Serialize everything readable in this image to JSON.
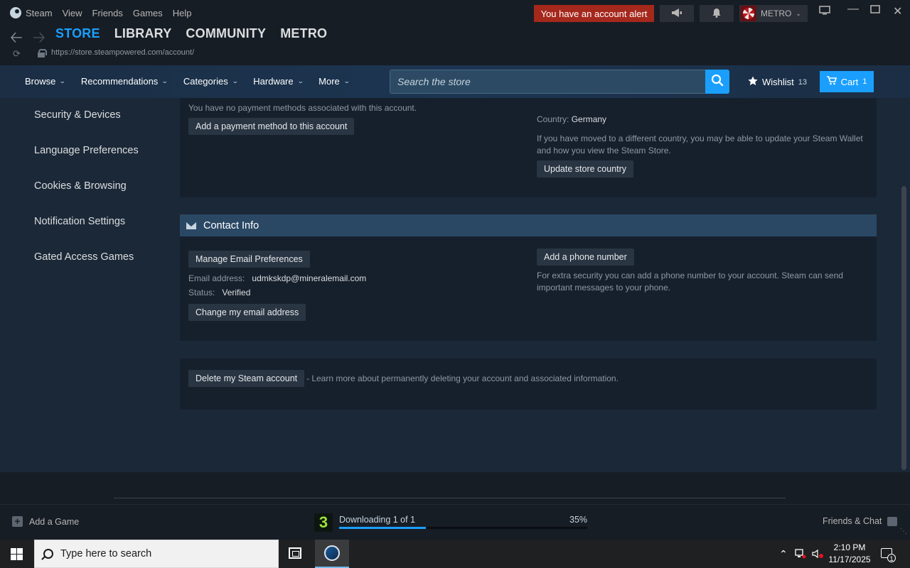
{
  "titlebar": {
    "app": "Steam",
    "menu": [
      "View",
      "Friends",
      "Games",
      "Help"
    ],
    "alert": "You have an account alert",
    "username": "METRO"
  },
  "nav": {
    "tabs": [
      "STORE",
      "LIBRARY",
      "COMMUNITY",
      "METRO"
    ],
    "url": "https://store.steampowered.com/account/"
  },
  "store": {
    "menu": [
      "Browse",
      "Recommendations",
      "Categories",
      "Hardware",
      "More"
    ],
    "search_placeholder": "Search the store",
    "wishlist_label": "Wishlist",
    "wishlist_count": "13",
    "cart_label": "Cart",
    "cart_count": "1"
  },
  "sidebar": {
    "items": [
      "Security & Devices",
      "Language Preferences",
      "Cookies & Browsing",
      "Notification Settings",
      "Gated Access Games"
    ]
  },
  "payment": {
    "no_methods": "You have no payment methods associated with this account.",
    "add_button": "Add a payment method to this account",
    "country_label": "Country:",
    "country_value": "Germany",
    "country_note": "If you have moved to a different country, you may be able to update your Steam Wallet and how you view the Steam Store.",
    "update_button": "Update store country"
  },
  "contact": {
    "header": "Contact Info",
    "manage_email_button": "Manage Email Preferences",
    "email_label": "Email address:",
    "email_value": "udmkskdp@mineralemail.com",
    "status_label": "Status:",
    "status_value": "Verified",
    "change_email_button": "Change my email address",
    "add_phone_button": "Add a phone number",
    "phone_note": "For extra security you can add a phone number to your account. Steam can send important messages to your phone."
  },
  "delete": {
    "button": "Delete my Steam account",
    "note": "- Learn more about permanently deleting your account and associated information."
  },
  "bottom": {
    "add_game": "Add a Game",
    "download_text": "Downloading 1 of 1",
    "download_pct": "35%",
    "download_progress": 0.35,
    "friends": "Friends & Chat"
  },
  "taskbar": {
    "search_placeholder": "Type here to search",
    "time": "2:10 PM",
    "date": "11/17/2025",
    "notif_count": "1"
  },
  "colors": {
    "accent": "#1a9fff",
    "alert": "#a5281d",
    "background": "#1b2838"
  }
}
